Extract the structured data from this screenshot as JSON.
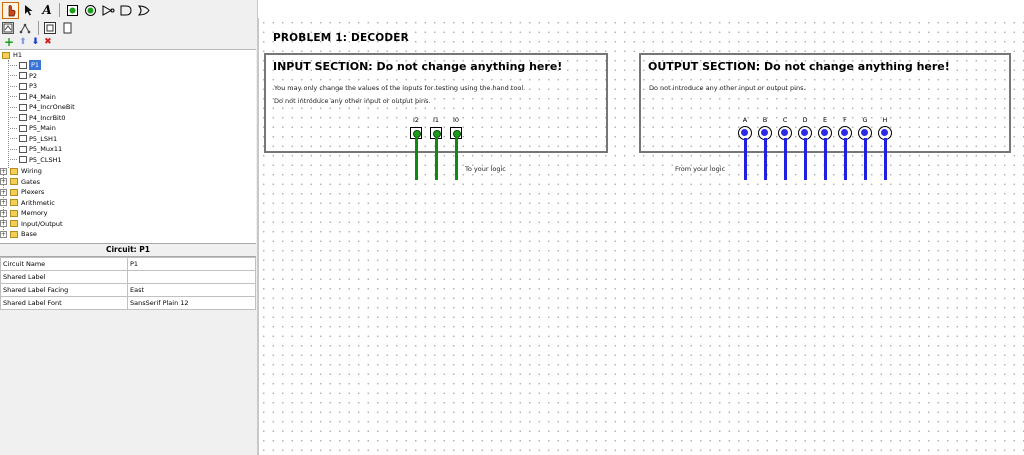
{
  "toolbar": {
    "tools": [
      "poke-tool-icon",
      "select-tool-icon",
      "text-tool-icon",
      "input-pin-icon",
      "output-pin-icon",
      "not-gate-icon",
      "and-gate-icon",
      "or-gate-icon"
    ],
    "text_tool_glyph": "A",
    "add_symbol": "+",
    "up_symbol": "⬆",
    "down_symbol": "⬇",
    "delete_symbol": "✖"
  },
  "tree": {
    "root": "H1",
    "circuits": [
      "P1",
      "P2",
      "P3",
      "P4_Main",
      "P4_IncrOneBit",
      "P4_IncrBit0",
      "P5_Main",
      "P5_LSH1",
      "P5_Mux11",
      "P5_CLSH1"
    ],
    "libraries": [
      "Wiring",
      "Gates",
      "Plexers",
      "Arithmetic",
      "Memory",
      "Input/Output",
      "Base"
    ],
    "expander_symbol": "+"
  },
  "properties": {
    "header": "Circuit: P1",
    "rows": [
      {
        "key": "Circuit Name",
        "value": "P1"
      },
      {
        "key": "Shared Label",
        "value": ""
      },
      {
        "key": "Shared Label Facing",
        "value": "East"
      },
      {
        "key": "Shared Label Font",
        "value": "SansSerif Plain 12"
      }
    ]
  },
  "canvas": {
    "title": "PROBLEM 1: DECODER",
    "input_section": {
      "heading": "INPUT SECTION: Do not change anything here!",
      "line1": "You may only change the values of the inputs for testing using the hand tool.",
      "line2": "Do not introduce any other input or output pins.",
      "pins": [
        "I2",
        "I1",
        "I0"
      ],
      "pin_value": "0",
      "note": "To your logic"
    },
    "output_section": {
      "heading": "OUTPUT SECTION: Do not change anything here!",
      "line1": "Do not introduce any other input or output pins.",
      "pins": [
        "A",
        "B",
        "C",
        "D",
        "E",
        "F",
        "G",
        "H"
      ],
      "note": "From your logic"
    }
  },
  "colors": {
    "input_wire": "#0f8a0f",
    "output_wire": "#2020e0",
    "selection": "#3875d7"
  }
}
